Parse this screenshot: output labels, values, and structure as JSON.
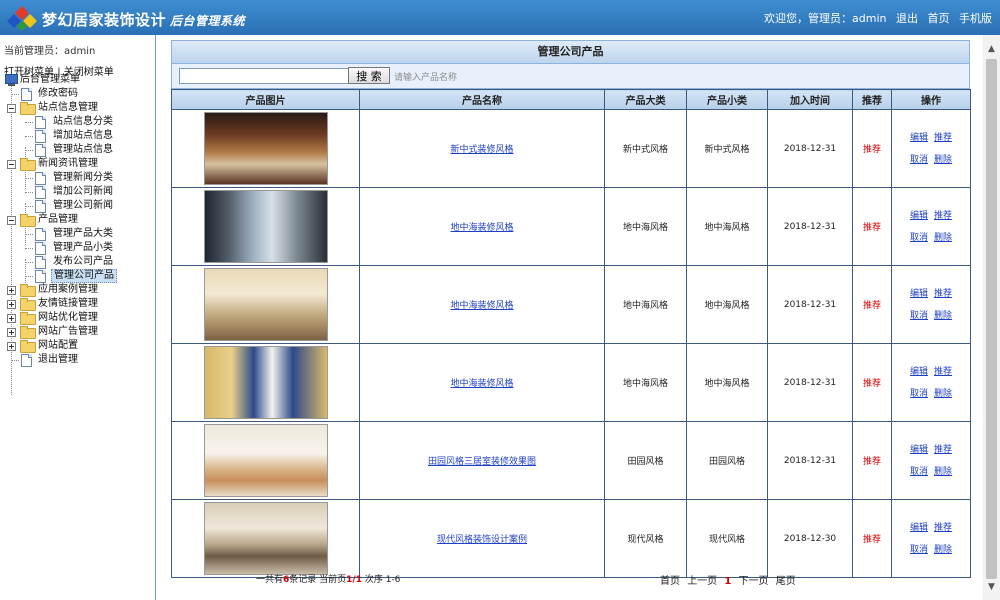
{
  "header": {
    "title": "梦幻居家装饰设计",
    "subtitle": "后台管理系统",
    "welcome": "欢迎您，管理员：admin",
    "links": [
      "退出",
      "首页",
      "手机版"
    ]
  },
  "sidebar": {
    "current_admin": "当前管理员：admin",
    "open_tree": "打开树菜单",
    "separator": "|",
    "close_tree": "关闭树菜单",
    "root": "后台管理菜单",
    "items": [
      {
        "label": "修改密码"
      },
      {
        "label": "站点信息管理"
      },
      {
        "label": "站点信息分类"
      },
      {
        "label": "增加站点信息"
      },
      {
        "label": "管理站点信息"
      },
      {
        "label": "新闻资讯管理"
      },
      {
        "label": "管理新闻分类"
      },
      {
        "label": "增加公司新闻"
      },
      {
        "label": "管理公司新闻"
      },
      {
        "label": "产品管理"
      },
      {
        "label": "管理产品大类"
      },
      {
        "label": "管理产品小类"
      },
      {
        "label": "发布公司产品"
      },
      {
        "label": "管理公司产品"
      },
      {
        "label": "应用案例管理"
      },
      {
        "label": "友情链接管理"
      },
      {
        "label": "网站优化管理"
      },
      {
        "label": "网站广告管理"
      },
      {
        "label": "网站配置"
      },
      {
        "label": "退出管理"
      }
    ]
  },
  "main": {
    "panel_title": "管理公司产品",
    "search_button": "搜 索",
    "search_hint": "请输入产品名称",
    "columns": [
      "产品图片",
      "产品名称",
      "产品大类",
      "产品小类",
      "加入时间",
      "推荐",
      "操作"
    ],
    "rows": [
      {
        "name": "新中式装修风格",
        "category": "新中式风格",
        "subcategory": "新中式风格",
        "date": "2018-12-31",
        "recommend": "推荐"
      },
      {
        "name": "地中海装修风格",
        "category": "地中海风格",
        "subcategory": "地中海风格",
        "date": "2018-12-31",
        "recommend": "推荐"
      },
      {
        "name": "地中海装修风格",
        "category": "地中海风格",
        "subcategory": "地中海风格",
        "date": "2018-12-31",
        "recommend": "推荐"
      },
      {
        "name": "地中海装修风格",
        "category": "地中海风格",
        "subcategory": "地中海风格",
        "date": "2018-12-31",
        "recommend": "推荐"
      },
      {
        "name": "田园风格三居室装修效果图",
        "category": "田园风格",
        "subcategory": "田园风格",
        "date": "2018-12-31",
        "recommend": "推荐"
      },
      {
        "name": "现代风格装饰设计案例",
        "category": "现代风格",
        "subcategory": "现代风格",
        "date": "2018-12-30",
        "recommend": "推荐"
      }
    ],
    "ops": {
      "edit": "编辑",
      "recommend": "推荐",
      "cancel": "取消",
      "delete": "删除"
    }
  },
  "footer": {
    "summary_pre": "一共有",
    "total": "6",
    "summary_mid": "条记录 当前页",
    "page": "1/1",
    "summary_post": " 次序 1-6",
    "pager": {
      "first": "首页",
      "prev": "上一页",
      "current": "1",
      "next": "下一页",
      "last": "尾页"
    }
  },
  "colors": {
    "header": "#2f7cc4",
    "accent_red": "#d20000",
    "link": "#1e3fc7",
    "table_header": "#c6dbf1"
  },
  "icons": {
    "logo": "diamond-logo-icon",
    "scroll_up": "chevron-up-icon",
    "scroll_down": "chevron-down-icon"
  }
}
